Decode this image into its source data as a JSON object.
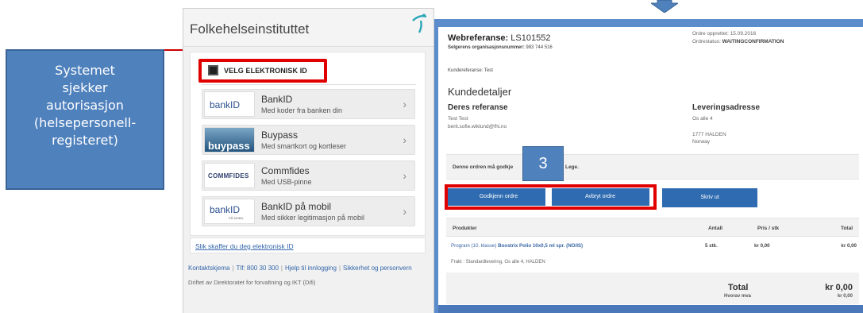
{
  "callout": {
    "lines": [
      "Systemet",
      "sjekker",
      "autorisasjon",
      "(helsepersonell-",
      "registeret)"
    ]
  },
  "login": {
    "title": "Folkehelseinstituttet",
    "heading": "VELG ELEKTRONISK ID",
    "options": [
      {
        "name": "BankID",
        "sub": "Med koder fra banken din",
        "logo": "bankID"
      },
      {
        "name": "Buypass",
        "sub": "Med smartkort og kortleser",
        "logo": "buypass"
      },
      {
        "name": "Commfides",
        "sub": "Med USB-pinne",
        "logo": "COMMFIDES"
      },
      {
        "name": "BankID på mobil",
        "sub": "Med sikker legitimasjon på mobil",
        "logo": "bankID",
        "logo_sub": "PÅ MOBIL"
      }
    ],
    "link": "Slik skaffer du deg elektronisk ID",
    "footer": [
      "Kontaktskjema",
      "Tlf: 800 30 300",
      "Hjelp til innlogging",
      "Sikkerhet og personvern"
    ],
    "footer2": "Driftet av Direktoratet for forvaltning og IKT (Difi)"
  },
  "order": {
    "webref_label": "Webreferanse:",
    "webref_value": "LS101552",
    "seller_label": "Selgerens organisasjonsnummer:",
    "seller_value": "983 744 516",
    "created": "Ordre opprettet: 15.09.2016",
    "status_label": "Ordrestatus:",
    "status_value": "WAITINGCONFIRMATION",
    "kunderef": "Kundereferanse: Test",
    "kundedetaljer": "Kundedetaljer",
    "deres_ref": "Deres referanse",
    "name": "Test Test",
    "email": "berit.sofie.wiklund@fhi.no",
    "leveringsadresse": "Leveringsadresse",
    "addr1": "Os alle 4",
    "addr2": "1777 HALDEN",
    "addr3": "Norway",
    "notice_a": "Denne ordren må godkje",
    "notice_b": "pr. Lege.",
    "step": "3",
    "buttons": {
      "approve": "Godkjenn ordre",
      "cancel": "Avbryt ordre",
      "print": "Skriv ut"
    },
    "cols": {
      "products": "Produkter",
      "qty": "Antall",
      "price": "Pris / stk",
      "total": "Total"
    },
    "row": {
      "prefix": "Program (10. klasse)",
      "product": "Boostrix Polio 10x0,5 ml spr. (NO/IS)",
      "qty": "5 stk.",
      "price": "kr 0,00",
      "total": "kr 0,00"
    },
    "frakt": "Frakt : Standardlevering, Os alle 4, HALDEN",
    "total_label": "Total",
    "total_value": "kr 0,00",
    "mva_label": "Hvorav mva",
    "mva_value": "kr 0,00"
  }
}
